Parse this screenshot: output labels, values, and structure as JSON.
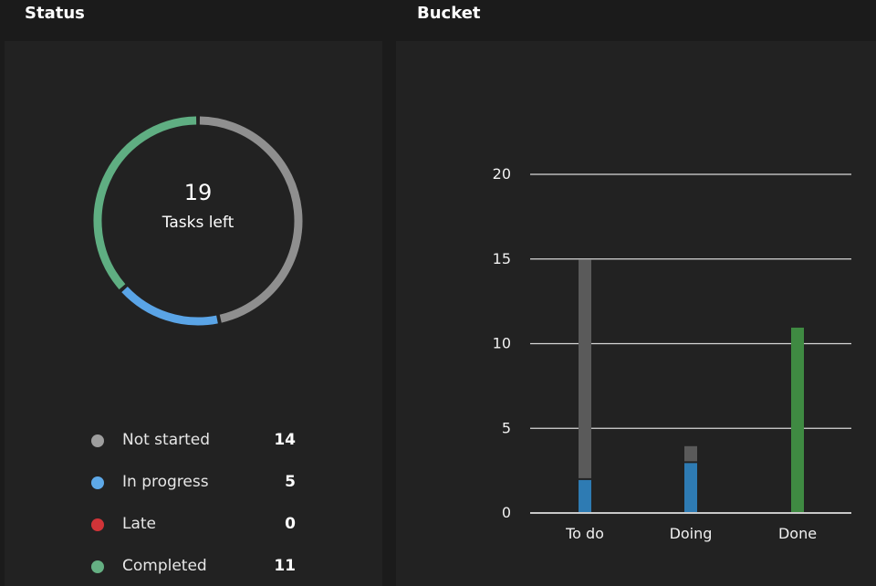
{
  "headers": {
    "status": "Status",
    "bucket": "Bucket"
  },
  "status_summary": {
    "tasks_left_count": "19",
    "tasks_left_label": "Tasks left"
  },
  "legend": [
    {
      "label": "Not started",
      "value": "14",
      "color": "#9e9e9e"
    },
    {
      "label": "In progress",
      "value": "5",
      "color": "#5ea9e8"
    },
    {
      "label": "Late",
      "value": "0",
      "color": "#d13438"
    },
    {
      "label": "Completed",
      "value": "11",
      "color": "#65b083"
    }
  ],
  "colors": {
    "not_started": "#8f8f8f",
    "in_progress": "#5aa4e6",
    "completed": "#5fae82",
    "bar_not_started": "#5a5a5a",
    "bar_in_progress": "#2e7bb3",
    "bar_completed": "#3f8a42",
    "gridline": "#d8d8d8"
  },
  "chart_data": {
    "type": "bar",
    "categories": [
      "To do",
      "Doing",
      "Done"
    ],
    "series": [
      {
        "name": "In progress",
        "values": [
          2,
          3,
          0
        ]
      },
      {
        "name": "Not started",
        "values": [
          13,
          1,
          0
        ]
      },
      {
        "name": "Completed",
        "values": [
          0,
          0,
          11
        ]
      }
    ],
    "ylim": [
      0,
      20
    ],
    "yticks": [
      0,
      5,
      10,
      15,
      20
    ],
    "grid": true
  }
}
